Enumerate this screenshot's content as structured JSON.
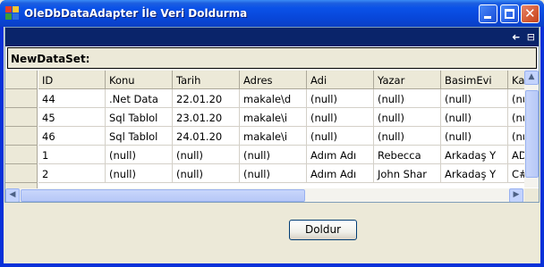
{
  "window": {
    "title": "OleDbDataAdapter İle Veri Doldurma",
    "minimize_icon": "minimize-icon",
    "maximize_icon": "maximize-icon",
    "close_icon": "close-icon"
  },
  "grid": {
    "caption_icons": [
      "back-arrow-icon",
      "show-parent-rows-icon"
    ],
    "back_glyph": "➜",
    "parent_glyph": "⊟",
    "parent_label": "NewDataSet:",
    "columns": [
      "ID",
      "Konu",
      "Tarih",
      "Adres",
      "Adi",
      "Yazar",
      "BasimEvi",
      "Ka"
    ],
    "rows": [
      [
        "44",
        ".Net Data",
        "22.01.20",
        "makale\\d",
        "(null)",
        "(null)",
        "(null)",
        "(nu"
      ],
      [
        "45",
        "Sql Tablol",
        "23.01.20",
        "makale\\i",
        "(null)",
        "(null)",
        "(null)",
        "(nu"
      ],
      [
        "46",
        "Sql Tablol",
        "24.01.20",
        "makale\\i",
        "(null)",
        "(null)",
        "(null)",
        "(nu"
      ],
      [
        "1",
        "(null)",
        "(null)",
        "(null)",
        "Adım Adı",
        "Rebecca",
        "Arkadaş Y",
        "AD"
      ],
      [
        "2",
        "(null)",
        "(null)",
        "(null)",
        "Adım Adı",
        "John Shar",
        "Arkadaş Y",
        "C#"
      ]
    ]
  },
  "buttons": {
    "fill_label": "Doldur"
  },
  "colors": {
    "titlebar": "#0a52e8",
    "grid_caption": "#0a246a",
    "face": "#ece9d8"
  }
}
